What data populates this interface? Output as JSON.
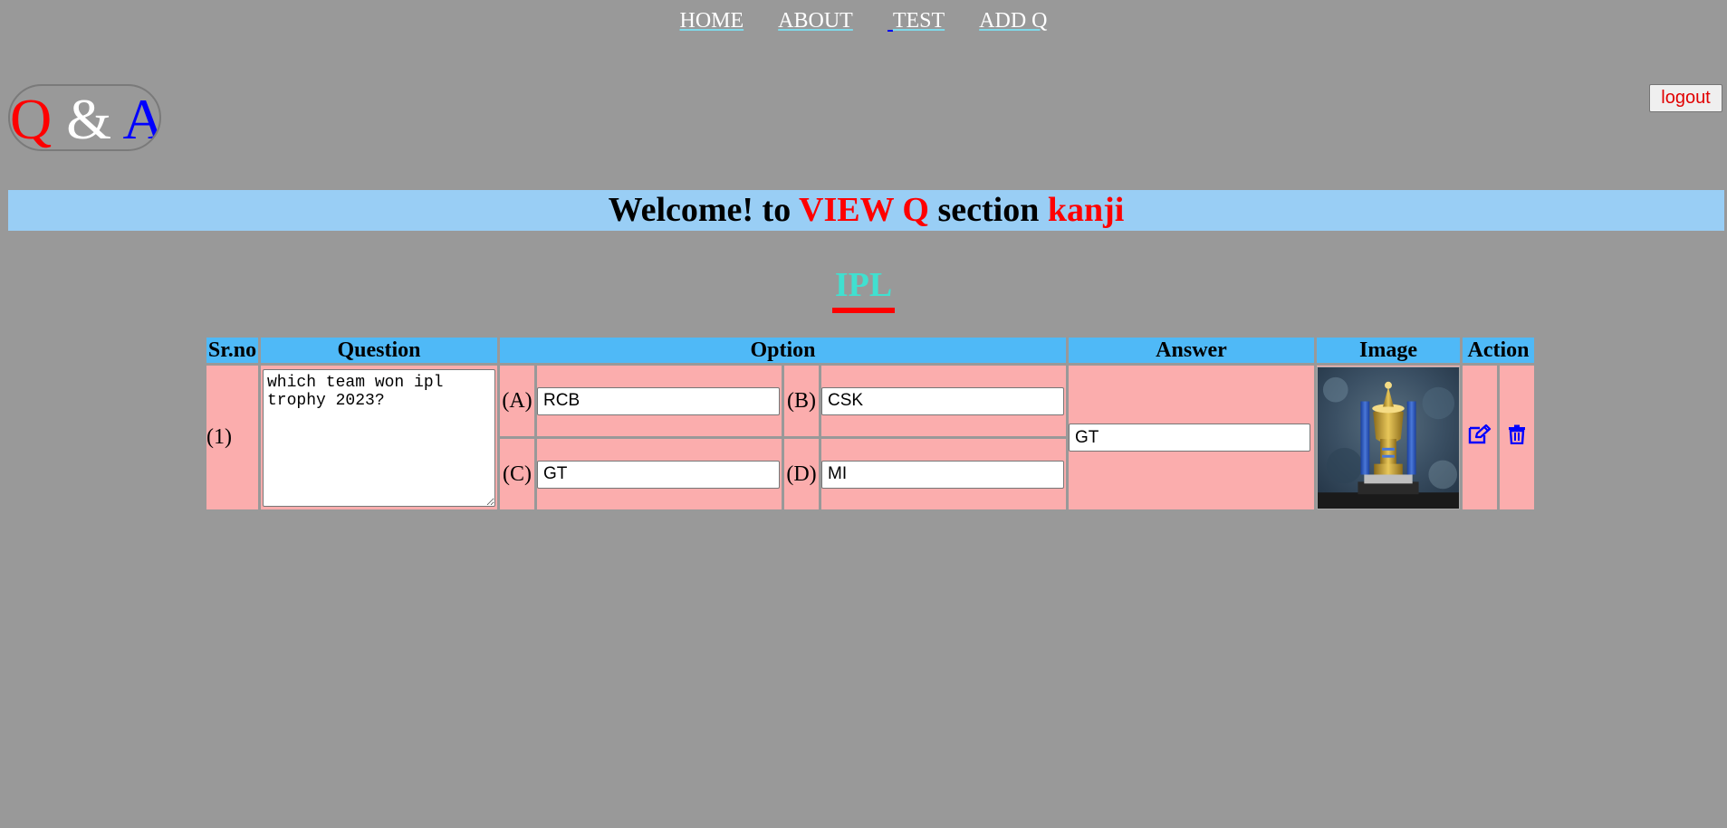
{
  "nav": {
    "items": [
      "HOME",
      "ABOUT",
      "TEST",
      "ADD Q"
    ]
  },
  "logo": {
    "q": "Q",
    "amp": "&",
    "a": "A"
  },
  "logout_label": "logout",
  "banner": {
    "part1": "Welcome! to ",
    "part2": "VIEW Q",
    "part3": " section ",
    "part4": "kanji"
  },
  "category_title": "IPL",
  "table": {
    "headers": {
      "srno": "Sr.no",
      "question": "Question",
      "option": "Option",
      "answer": "Answer",
      "image": "Image",
      "action": "Action"
    },
    "rows": [
      {
        "srno": "(1)",
        "question": "which team won ipl trophy 2023?",
        "options": [
          {
            "letter": "(A)",
            "value": "RCB"
          },
          {
            "letter": "(B)",
            "value": "CSK"
          },
          {
            "letter": "(C)",
            "value": "GT"
          },
          {
            "letter": "(D)",
            "value": "MI"
          }
        ],
        "answer": "GT",
        "image": "ipl-trophy-photo"
      }
    ]
  },
  "icons": {
    "edit": "edit-icon",
    "delete": "trash-icon"
  },
  "colors": {
    "background": "#999999",
    "banner": "#99cef5",
    "header": "#4fb9f7",
    "row": "#fbadad",
    "accent_red": "#ff0000",
    "accent_blue": "#0000ff",
    "title_teal": "#40e0d0"
  }
}
